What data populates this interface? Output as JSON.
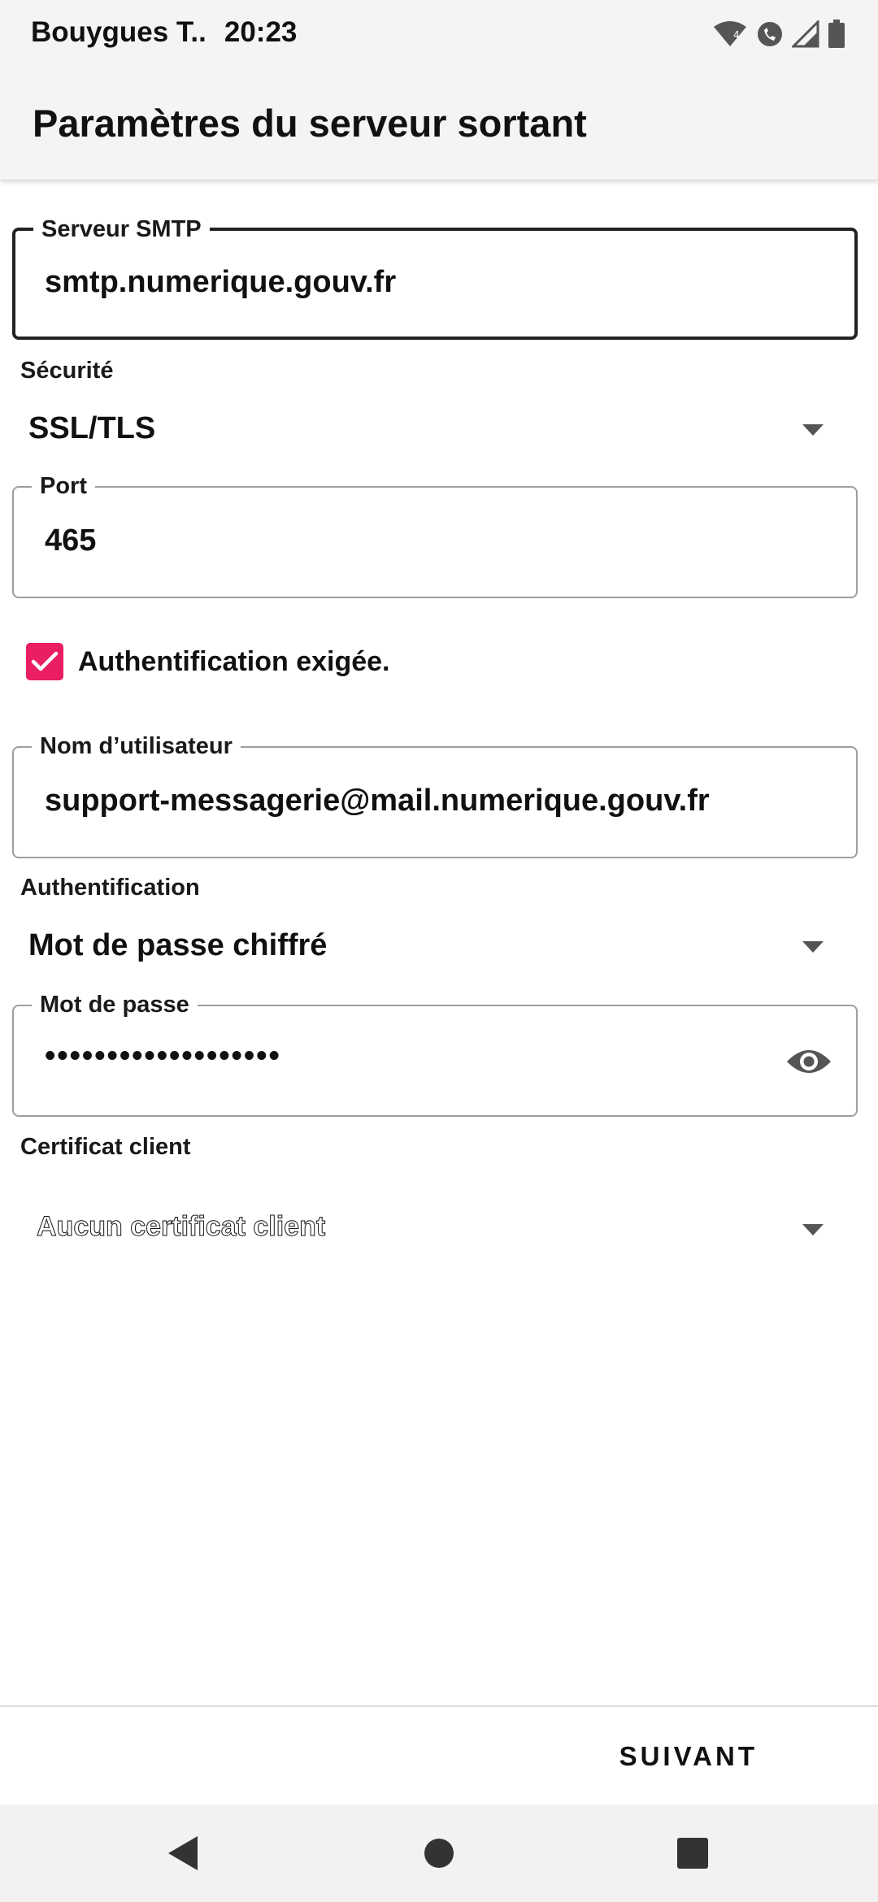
{
  "status_bar": {
    "carrier": "Bouygues T..",
    "time": "20:23"
  },
  "app_bar": {
    "title": "Paramètres du serveur sortant"
  },
  "form": {
    "smtp_server": {
      "label": "Serveur SMTP",
      "value": "smtp.numerique.gouv.fr"
    },
    "security": {
      "label": "Sécurité",
      "value": "SSL/TLS"
    },
    "port": {
      "label": "Port",
      "value": "465"
    },
    "auth_required": {
      "label": "Authentification exigée.",
      "checked": true
    },
    "username": {
      "label": "Nom d’utilisateur",
      "value": "support-messagerie@mail.numerique.gouv.fr"
    },
    "authentication": {
      "label": "Authentification",
      "value": "Mot de passe chiffré"
    },
    "password": {
      "label": "Mot de passe",
      "value": "•••••••••••••••••••"
    },
    "client_certificate": {
      "label": "Certificat client",
      "value": "Aucun certificat client"
    }
  },
  "bottom_bar": {
    "next_label": "SUIVANT"
  },
  "icons": {
    "dropdown": "caret-down-icon",
    "password_toggle": "eye-icon",
    "checkbox": "check-icon"
  },
  "colors": {
    "accent": "#e91e63",
    "text": "#111111",
    "bar_background": "#f4f4f4",
    "field_border": "#9e9e9e"
  }
}
